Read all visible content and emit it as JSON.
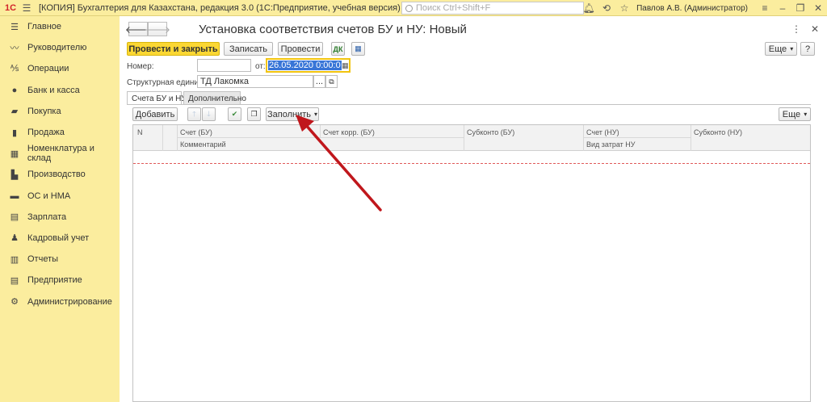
{
  "titlebar": {
    "logo": "1С",
    "title": "[КОПИЯ] Бухгалтерия для Казахстана, редакция 3.0  (1С:Предприятие, учебная версия)",
    "search_placeholder": "Поиск Ctrl+Shift+F",
    "user": "Павлов А.В. (Администратор)"
  },
  "sidebar": {
    "items": [
      {
        "label": "Главное",
        "icon": "menu-icon"
      },
      {
        "label": "Руководителю",
        "icon": "trend-icon"
      },
      {
        "label": "Операции",
        "icon": "operations-icon"
      },
      {
        "label": "Банк и касса",
        "icon": "bank-icon"
      },
      {
        "label": "Покупка",
        "icon": "purchase-icon"
      },
      {
        "label": "Продажа",
        "icon": "sale-icon"
      },
      {
        "label": "Номенклатура и склад",
        "icon": "warehouse-icon"
      },
      {
        "label": "Производство",
        "icon": "factory-icon"
      },
      {
        "label": "ОС и НМА",
        "icon": "truck-icon"
      },
      {
        "label": "Зарплата",
        "icon": "salary-icon"
      },
      {
        "label": "Кадровый учет",
        "icon": "people-icon"
      },
      {
        "label": "Отчеты",
        "icon": "reports-icon"
      },
      {
        "label": "Предприятие",
        "icon": "enterprise-icon"
      },
      {
        "label": "Администрирование",
        "icon": "gear-icon"
      }
    ]
  },
  "form": {
    "title": "Установка соответствия счетов БУ и НУ: Новый",
    "toolbar": {
      "post_close": "Провести и закрыть",
      "save": "Записать",
      "post": "Провести",
      "more": "Еще",
      "help": "?"
    },
    "number_label": "Номер:",
    "number_value": "",
    "date_label": "от:",
    "date_value": "26.05.2020  0:00:0",
    "unit_label": "Структурная единица:",
    "unit_value": "ТД Лакомка",
    "unit_select": "...",
    "tabs": [
      {
        "label": "Счета БУ и НУ",
        "active": true
      },
      {
        "label": "Дополнительно",
        "active": false
      }
    ],
    "table_toolbar": {
      "add": "Добавить",
      "fill": "Заполнить",
      "more": "Еще"
    },
    "table_headers": {
      "n": "N",
      "account_bu": "Счет (БУ)",
      "comment": "Комментарий",
      "corr_account_bu": "Счет корр. (БУ)",
      "subconto_bu": "Субконто (БУ)",
      "account_nu": "Счет (НУ)",
      "cost_type_nu": "Вид затрат НУ",
      "subconto_nu": "Субконто (НУ)"
    },
    "rows": []
  },
  "colors": {
    "accent_yellow": "#fbed9e",
    "primary_button": "#fbd733",
    "arrow": "#c0171c"
  }
}
